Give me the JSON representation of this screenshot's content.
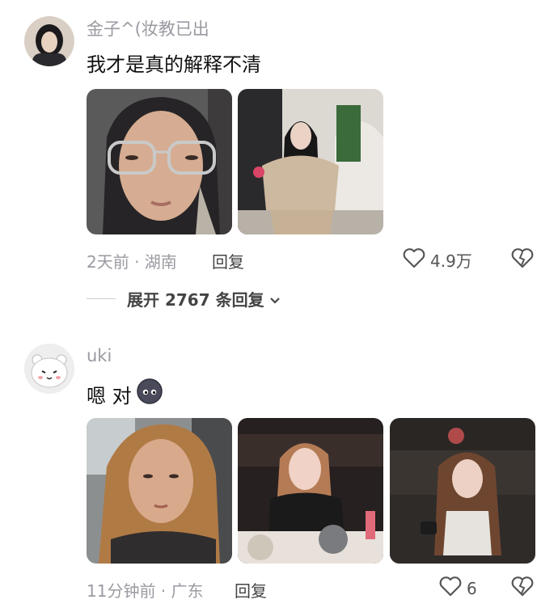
{
  "comments": [
    {
      "username": "金子^(妆教已出",
      "text": "我才是真的解释不清",
      "meta": "2天前 · 湖南",
      "reply_label": "回复",
      "likes": "4.9万",
      "expand_label": "展开 2767 条回复"
    },
    {
      "username": "uki",
      "text": "嗯 对",
      "meta": "11分钟前 · 广东",
      "reply_label": "回复",
      "likes": "6"
    }
  ],
  "colors": {
    "muted": "#9a9aa2",
    "text": "#111111",
    "background": "#ffffff"
  },
  "icons": [
    "heart-outline-icon",
    "broken-heart-icon",
    "chevron-down-icon",
    "emoji-icon"
  ]
}
